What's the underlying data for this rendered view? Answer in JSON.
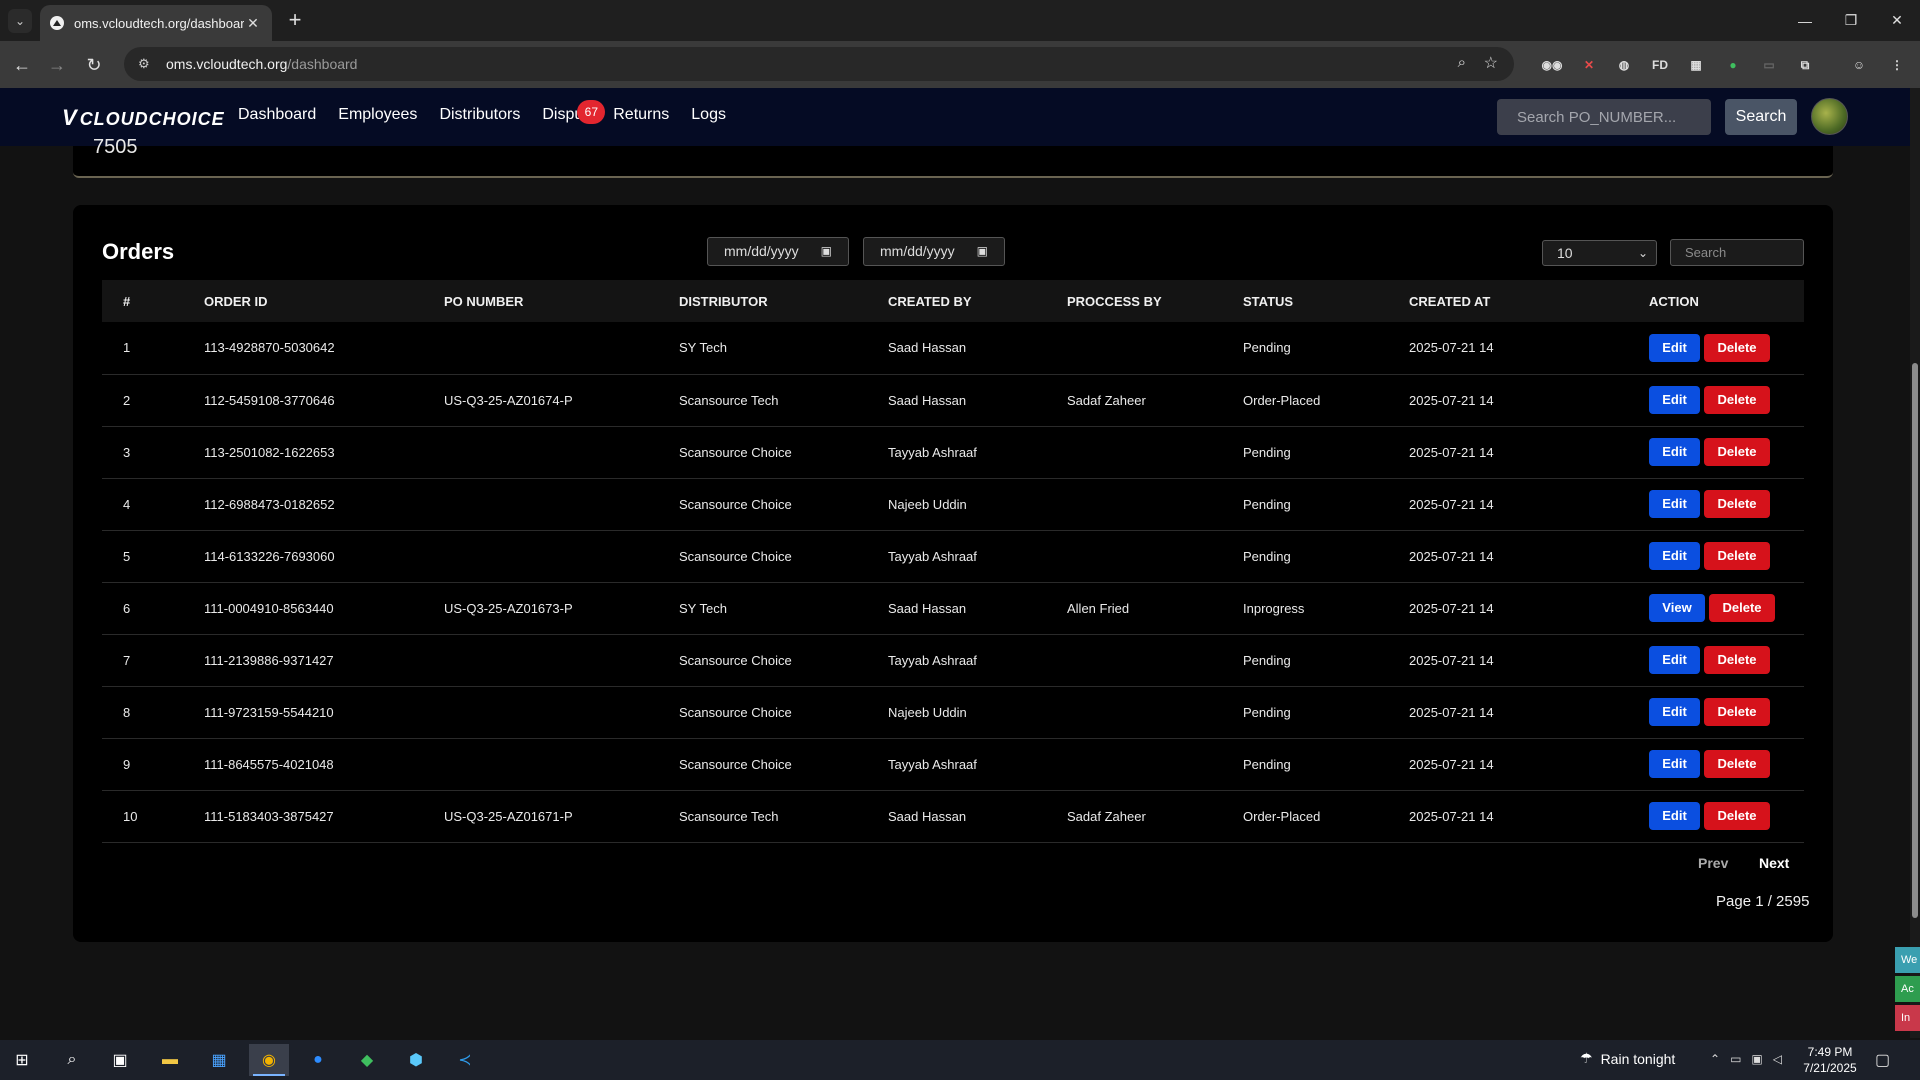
{
  "browser": {
    "tab_title": "oms.vcloudtech.org/dashboard",
    "url_host": "oms.vcloudtech.org",
    "url_path": "/dashboard",
    "extensions": [
      "FD"
    ]
  },
  "appnav": {
    "logo": "CLOUDCHOICE",
    "links": [
      "Dashboard",
      "Employees",
      "Distributors",
      "Dispu",
      "Returns",
      "Logs"
    ],
    "disputes_badge": "67",
    "search_placeholder": "Search PO_NUMBER...",
    "search_button": "Search"
  },
  "prev_card": {
    "value": "7505"
  },
  "orders": {
    "title": "Orders",
    "date_from_placeholder": "mm/dd/yyyy",
    "date_to_placeholder": "mm/dd/yyyy",
    "page_size": "10",
    "search_placeholder": "Search",
    "columns": [
      "#",
      "ORDER ID",
      "PO NUMBER",
      "DISTRIBUTOR",
      "CREATED BY",
      "PROCCESS BY",
      "STATUS",
      "CREATED AT",
      "ACTION"
    ],
    "rows": [
      {
        "n": "1",
        "order_id": "113-4928870-5030642",
        "po": "",
        "distributor": "SY Tech",
        "created_by": "Saad Hassan",
        "process_by": "",
        "status": "Pending",
        "created_at": "2025-07-21 14",
        "action": "Edit",
        "delete": "Delete"
      },
      {
        "n": "2",
        "order_id": "112-5459108-3770646",
        "po": "US-Q3-25-AZ01674-P",
        "distributor": "Scansource Tech",
        "created_by": "Saad Hassan",
        "process_by": "Sadaf Zaheer",
        "status": "Order-Placed",
        "created_at": "2025-07-21 14",
        "action": "Edit",
        "delete": "Delete"
      },
      {
        "n": "3",
        "order_id": "113-2501082-1622653",
        "po": "",
        "distributor": "Scansource Choice",
        "created_by": "Tayyab Ashraaf",
        "process_by": "",
        "status": "Pending",
        "created_at": "2025-07-21 14",
        "action": "Edit",
        "delete": "Delete"
      },
      {
        "n": "4",
        "order_id": "112-6988473-0182652",
        "po": "",
        "distributor": "Scansource Choice",
        "created_by": "Najeeb Uddin",
        "process_by": "",
        "status": "Pending",
        "created_at": "2025-07-21 14",
        "action": "Edit",
        "delete": "Delete"
      },
      {
        "n": "5",
        "order_id": "114-6133226-7693060",
        "po": "",
        "distributor": "Scansource Choice",
        "created_by": "Tayyab Ashraaf",
        "process_by": "",
        "status": "Pending",
        "created_at": "2025-07-21 14",
        "action": "Edit",
        "delete": "Delete"
      },
      {
        "n": "6",
        "order_id": "111-0004910-8563440",
        "po": "US-Q3-25-AZ01673-P",
        "distributor": "SY Tech",
        "created_by": "Saad Hassan",
        "process_by": "Allen Fried",
        "status": "Inprogress",
        "created_at": "2025-07-21 14",
        "action": "View",
        "delete": "Delete"
      },
      {
        "n": "7",
        "order_id": "111-2139886-9371427",
        "po": "",
        "distributor": "Scansource Choice",
        "created_by": "Tayyab Ashraaf",
        "process_by": "",
        "status": "Pending",
        "created_at": "2025-07-21 14",
        "action": "Edit",
        "delete": "Delete"
      },
      {
        "n": "8",
        "order_id": "111-9723159-5544210",
        "po": "",
        "distributor": "Scansource Choice",
        "created_by": "Najeeb Uddin",
        "process_by": "",
        "status": "Pending",
        "created_at": "2025-07-21 14",
        "action": "Edit",
        "delete": "Delete"
      },
      {
        "n": "9",
        "order_id": "111-8645575-4021048",
        "po": "",
        "distributor": "Scansource Choice",
        "created_by": "Tayyab Ashraaf",
        "process_by": "",
        "status": "Pending",
        "created_at": "2025-07-21 14",
        "action": "Edit",
        "delete": "Delete"
      },
      {
        "n": "10",
        "order_id": "111-5183403-3875427",
        "po": "US-Q3-25-AZ01671-P",
        "distributor": "Scansource Tech",
        "created_by": "Saad Hassan",
        "process_by": "Sadaf Zaheer",
        "status": "Order-Placed",
        "created_at": "2025-07-21 14",
        "action": "Edit",
        "delete": "Delete"
      }
    ],
    "prev": "Prev",
    "next": "Next",
    "page_info": "Page 1 / 2595"
  },
  "side_tabs": [
    "We",
    "Ac",
    "In"
  ],
  "taskbar": {
    "weather": "Rain tonight",
    "time": "7:49 PM",
    "date": "7/21/2025"
  },
  "colors": {
    "edit": "#0b4fe0",
    "delete": "#d6121b",
    "badge": "#e3262f",
    "nav_bg": "#050b24"
  }
}
